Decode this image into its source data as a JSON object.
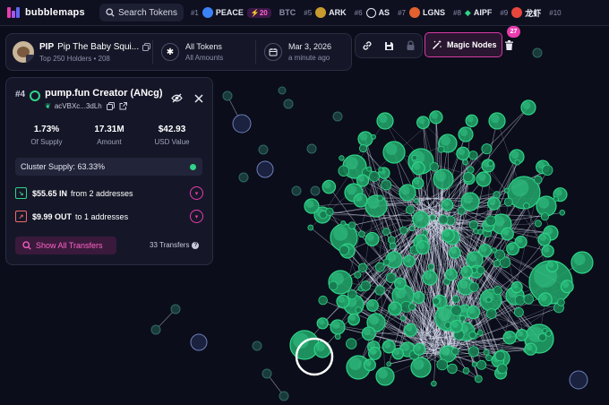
{
  "app": {
    "name": "bubblemaps",
    "search_label": "Search Tokens"
  },
  "ticker": [
    {
      "rank": "#1",
      "symbol": "PEACE",
      "color": "#3b82f6",
      "badge": "⚡20"
    },
    {
      "rank": "",
      "symbol": "BTC",
      "color": "",
      "badge": ""
    },
    {
      "rank": "#5",
      "symbol": "ARK",
      "color": "#c99a2e",
      "badge": ""
    },
    {
      "rank": "#6",
      "symbol": "AS",
      "color": "#e8e9f2",
      "badge": ""
    },
    {
      "rank": "#7",
      "symbol": "LGNS",
      "color": "#e2612e",
      "badge": ""
    },
    {
      "rank": "#8",
      "symbol": "AIPF",
      "color": "#2fd488",
      "badge": ""
    },
    {
      "rank": "#9",
      "symbol": "龙虾",
      "color": "#e8463c",
      "badge": ""
    },
    {
      "rank": "#10",
      "symbol": "",
      "color": "",
      "badge": ""
    }
  ],
  "token": {
    "symbol": "PIP",
    "name": "Pip The Baby Squi...",
    "holders_label": "Top 250 Holders • 208",
    "filter_title": "All Tokens",
    "filter_sub": "All Amounts",
    "date": "Mar 3, 2026",
    "updated": "a minute ago"
  },
  "toolbar": {
    "magic_label": "Magic Nodes",
    "magic_count": "27"
  },
  "detail": {
    "rank": "#4",
    "name": "pump.fun Creator (ANcg)",
    "address": "acVBXc...3dLh",
    "stats": [
      {
        "value": "1.73%",
        "label": "Of Supply"
      },
      {
        "value": "17.31M",
        "label": "Amount"
      },
      {
        "value": "$42.93",
        "label": "USD Value"
      }
    ],
    "cluster_supply": "Cluster Supply: 63.33%",
    "flow_in": {
      "amount": "$55.65 IN",
      "text": "from 2 addresses"
    },
    "flow_out": {
      "amount": "$9.99 OUT",
      "text": "to 1 addresses"
    },
    "show_all_label": "Show All Transfers",
    "transfers_count": "33 Transfers"
  },
  "colors": {
    "accent_pink": "#e83cad",
    "node_green": "#2fd488",
    "background": "#0b0d1a",
    "isolated_node": "#3a4a7a"
  }
}
